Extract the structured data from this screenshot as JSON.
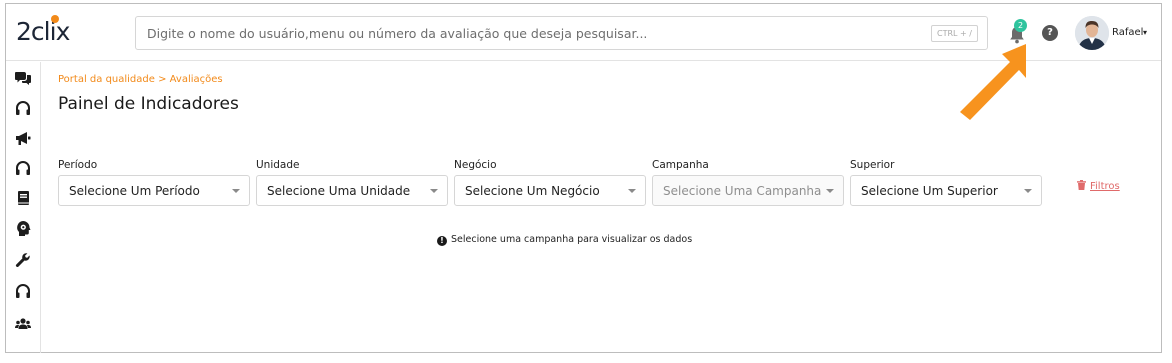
{
  "app": {
    "logo_text": "2clix"
  },
  "search": {
    "placeholder": "Digite o nome do usuário,menu ou número da avaliação que deseja pesquisar...",
    "shortcut": "CTRL + /"
  },
  "header": {
    "notifications_count": "2",
    "help_label": "?",
    "user_name": "Rafael",
    "user_caret": "▾"
  },
  "sidebar": {
    "items": [
      {
        "icon": "chat-bubbles-icon"
      },
      {
        "icon": "headphones-icon"
      },
      {
        "icon": "megaphone-icon"
      },
      {
        "icon": "headphones-icon"
      },
      {
        "icon": "book-icon"
      },
      {
        "icon": "head-gear-icon"
      },
      {
        "icon": "wrench-icon"
      },
      {
        "icon": "headphones-icon"
      },
      {
        "icon": "users-icon"
      }
    ]
  },
  "breadcrumb": "Portal da qualidade > Avaliações",
  "page_title": "Painel de Indicadores",
  "filters": [
    {
      "label": "Período",
      "value": "Selecione Um Período",
      "disabled": false
    },
    {
      "label": "Unidade",
      "value": "Selecione Uma Unidade",
      "disabled": false
    },
    {
      "label": "Negócio",
      "value": "Selecione Um Negócio",
      "disabled": false
    },
    {
      "label": "Campanha",
      "value": "Selecione Uma Campanha",
      "disabled": true
    },
    {
      "label": "Superior",
      "value": "Selecione Um Superior",
      "disabled": false
    }
  ],
  "filtros_button": "Filtros",
  "notice": {
    "icon_text": "!",
    "text": "Selecione uma campanha para visualizar os dados"
  },
  "colors": {
    "accent": "#f28a1a",
    "badge": "#2fc49e",
    "danger": "#e06a6a",
    "arrow": "#f7931e"
  }
}
